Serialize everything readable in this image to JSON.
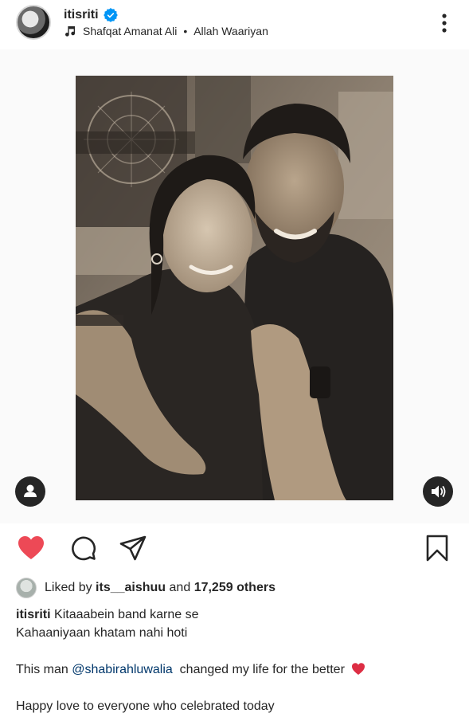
{
  "post": {
    "username": "itisriti",
    "verified": true,
    "music": {
      "artist": "Shafqat Amanat Ali",
      "separator": "•",
      "song": "Allah Waariyan"
    }
  },
  "actions": {
    "like_state": "liked",
    "like_color": "#ed4956"
  },
  "likes": {
    "prefix": "Liked by",
    "user": "its__aishuu",
    "and_word": "and",
    "others": "17,259 others"
  },
  "caption": {
    "username": "itisriti",
    "line1": "Kitaaabein band karne se",
    "line2": "Kahaaniyaan khatam nahi hoti",
    "line3_before": "This man",
    "mention": "@shabirahluwalia",
    "line3_after": "changed my life for the better",
    "line4": "Happy love to everyone who celebrated today"
  },
  "colors": {
    "text": "#262626",
    "mention": "#00376b",
    "verified_badge": "#0095f6",
    "heart": "#ed4956"
  },
  "icons": {
    "more": "more-vertical-icon",
    "music": "music-note-icon",
    "like": "heart-icon",
    "comment": "comment-icon",
    "share": "send-icon",
    "save": "bookmark-icon",
    "tagged": "person-icon",
    "sound": "sound-icon"
  }
}
